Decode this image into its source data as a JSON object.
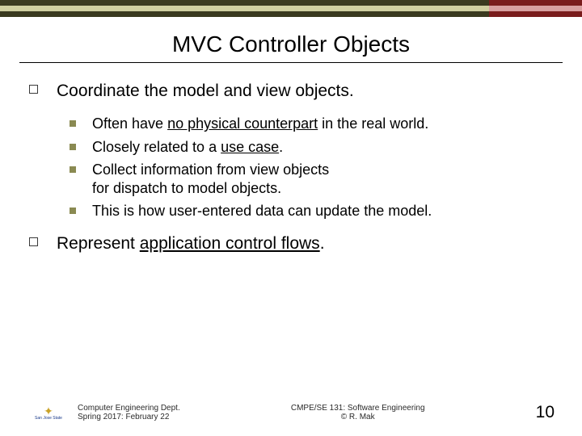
{
  "title": "MVC Controller Objects",
  "bullets": {
    "b1": {
      "text": "Coordinate the model and view objects.",
      "sub": {
        "s1": {
          "pre": "Often have ",
          "u": "no physical counterpart",
          "post": " in the real world."
        },
        "s2": {
          "pre": "Closely related to a ",
          "u": "use case",
          "post": "."
        },
        "s3": {
          "text": "Collect information from view objects\nfor dispatch to model objects."
        },
        "s4": {
          "text": "This is how user-entered data can update the model."
        }
      }
    },
    "b2": {
      "pre": "Represent ",
      "u": "application control flows",
      "post": "."
    }
  },
  "footer": {
    "logo_text": "San Jose State",
    "left_line1": "Computer Engineering Dept.",
    "left_line2": "Spring 2017: February 22",
    "center_line1": "CMPE/SE 131: Software Engineering",
    "center_line2": "© R. Mak",
    "pagenum": "10"
  }
}
